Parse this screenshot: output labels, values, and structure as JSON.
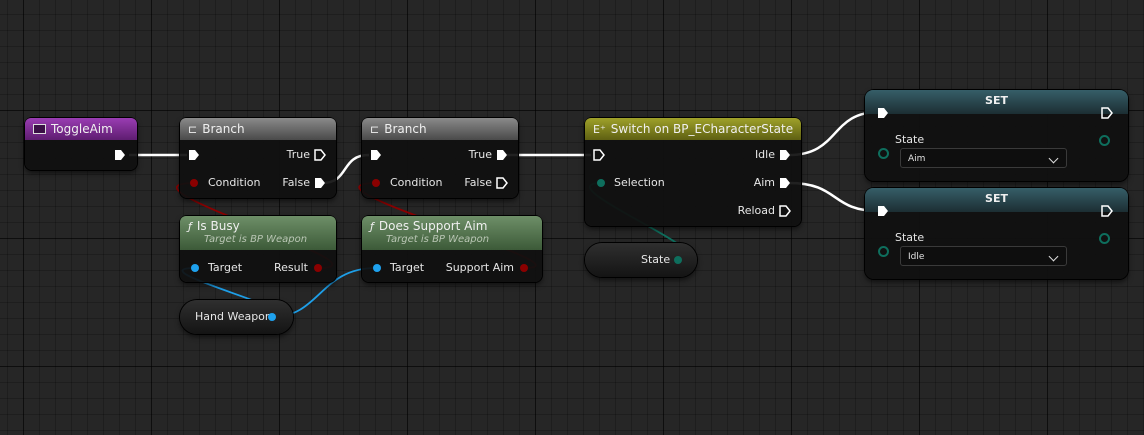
{
  "event_node": {
    "title": "ToggleAim",
    "color": "#8c2fa3"
  },
  "branch_1": {
    "title": "Branch",
    "condition_label": "Condition",
    "true_label": "True",
    "false_label": "False"
  },
  "branch_2": {
    "title": "Branch",
    "condition_label": "Condition",
    "true_label": "True",
    "false_label": "False"
  },
  "switch_node": {
    "title": "Switch on BP_ECharacterState",
    "selection_label": "Selection",
    "outputs": [
      "Idle",
      "Aim",
      "Reload"
    ],
    "color": "#8a8c1c"
  },
  "is_busy": {
    "title": "Is Busy",
    "subtitle": "Target is BP Weapon",
    "target_label": "Target",
    "result_label": "Result"
  },
  "does_support_aim": {
    "title": "Does Support Aim",
    "subtitle": "Target is BP Weapon",
    "target_label": "Target",
    "result_label": "Support Aim"
  },
  "hand_weapon": {
    "label": "Hand Weapon"
  },
  "state_getter": {
    "label": "State"
  },
  "set_1": {
    "title": "SET",
    "var_label": "State",
    "value": "Aim"
  },
  "set_2": {
    "title": "SET",
    "var_label": "State",
    "value": "Idle"
  },
  "colors": {
    "exec": "#ffffff",
    "bool": "#920101",
    "object": "#1ea1ee",
    "enum": "#0b6b5a",
    "pure_header": "#4c6f47",
    "set_header": "#2b4a52"
  }
}
